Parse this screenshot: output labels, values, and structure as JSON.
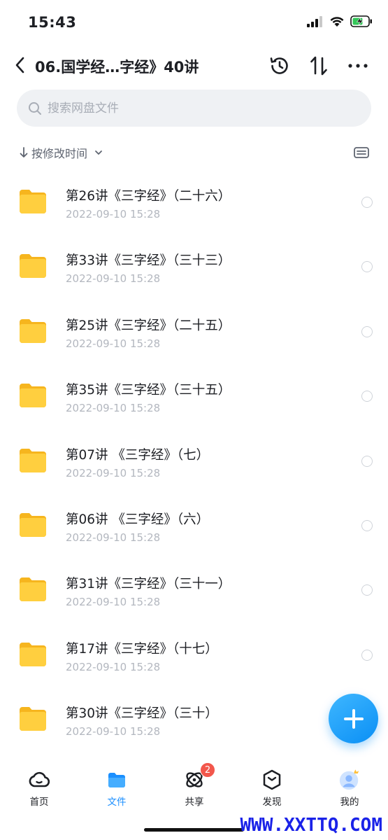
{
  "status_bar": {
    "time": "15:43"
  },
  "nav": {
    "title": "06.国学经…字经》40讲",
    "icons": [
      "back-chevron-icon",
      "history-icon",
      "sort-icon",
      "more-icon"
    ]
  },
  "search": {
    "placeholder": "搜索网盘文件"
  },
  "sort": {
    "label": "按修改时间"
  },
  "files": [
    {
      "name": "第26讲《三字经》（二十六）",
      "date": "2022-09-10 15:28"
    },
    {
      "name": "第33讲《三字经》（三十三）",
      "date": "2022-09-10 15:28"
    },
    {
      "name": "第25讲《三字经》（二十五）",
      "date": "2022-09-10 15:28"
    },
    {
      "name": "第35讲《三字经》（三十五）",
      "date": "2022-09-10 15:28"
    },
    {
      "name": "第07讲 《三字经》（七）",
      "date": "2022-09-10 15:28"
    },
    {
      "name": "第06讲 《三字经》（六）",
      "date": "2022-09-10 15:28"
    },
    {
      "name": "第31讲《三字经》（三十一）",
      "date": "2022-09-10 15:28"
    },
    {
      "name": "第17讲《三字经》（十七）",
      "date": "2022-09-10 15:28"
    },
    {
      "name": "第30讲《三字经》（三十）",
      "date": "2022-09-10 15:28"
    }
  ],
  "tabs": [
    {
      "label": "首页",
      "icon": "cloud-icon"
    },
    {
      "label": "文件",
      "icon": "folder-icon"
    },
    {
      "label": "共享",
      "icon": "orbit-icon",
      "badge": "2"
    },
    {
      "label": "发现",
      "icon": "discover-cube-icon"
    },
    {
      "label": "我的",
      "icon": "avatar-icon"
    }
  ],
  "watermark": "WWW.XXTTQ.COM",
  "colors": {
    "accent": "#1b8fff",
    "folder": "#ffc93a",
    "badge": "#f2574c",
    "watermark": "#1a22e8"
  }
}
